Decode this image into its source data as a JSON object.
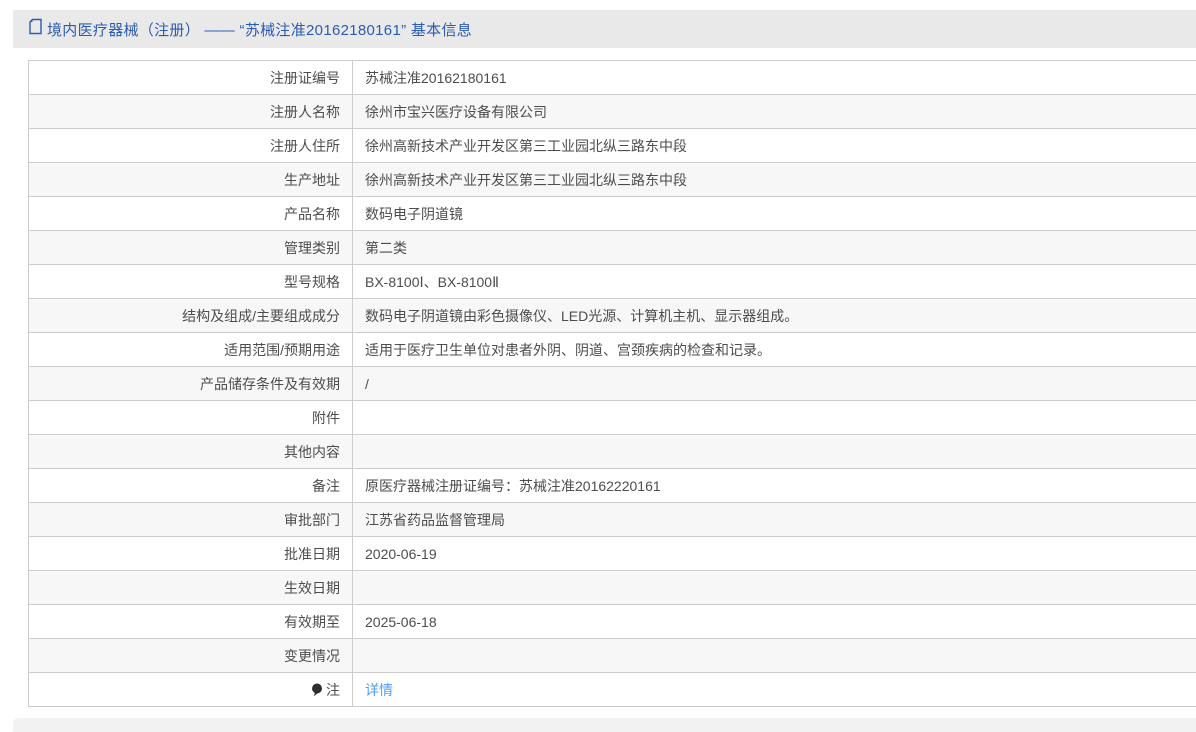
{
  "header": {
    "icon": "document-icon",
    "title": "境内医疗器械（注册） —— “苏械注准20162180161” 基本信息"
  },
  "table": {
    "rows": [
      {
        "label": "注册证编号",
        "value": "苏械注准20162180161"
      },
      {
        "label": "注册人名称",
        "value": "徐州市宝兴医疗设备有限公司"
      },
      {
        "label": "注册人住所",
        "value": "徐州高新技术产业开发区第三工业园北纵三路东中段"
      },
      {
        "label": "生产地址",
        "value": "徐州高新技术产业开发区第三工业园北纵三路东中段"
      },
      {
        "label": "产品名称",
        "value": "数码电子阴道镜"
      },
      {
        "label": "管理类别",
        "value": "第二类"
      },
      {
        "label": "型号规格",
        "value": "BX-8100Ⅰ、BX-8100Ⅱ"
      },
      {
        "label": "结构及组成/主要组成成分",
        "value": "数码电子阴道镜由彩色摄像仪、LED光源、计算机主机、显示器组成。"
      },
      {
        "label": "适用范围/预期用途",
        "value": "适用于医疗卫生单位对患者外阴、阴道、宫颈疾病的检查和记录。"
      },
      {
        "label": "产品储存条件及有效期",
        "value": "/"
      },
      {
        "label": "附件",
        "value": ""
      },
      {
        "label": "其他内容",
        "value": ""
      },
      {
        "label": "备注",
        "value": "原医疗器械注册证编号：苏械注准20162220161"
      },
      {
        "label": "审批部门",
        "value": "江苏省药品监督管理局"
      },
      {
        "label": "批准日期",
        "value": "2020-06-19"
      },
      {
        "label": "生效日期",
        "value": ""
      },
      {
        "label": "有效期至",
        "value": "2025-06-18"
      },
      {
        "label": "变更情况",
        "value": ""
      },
      {
        "label": "注",
        "value": "详情",
        "icon": "balloon-note-icon",
        "value_is_link": true
      }
    ]
  },
  "colors": {
    "title_blue": "#2c5bb4",
    "link_blue": "#4f9df9",
    "header_bg": "#e9e9e9",
    "row_alt_bg": "#f7f7f7",
    "table_border": "#cccccc",
    "text": "#4d4d4d",
    "footer_bg": "#f2f2f2"
  }
}
